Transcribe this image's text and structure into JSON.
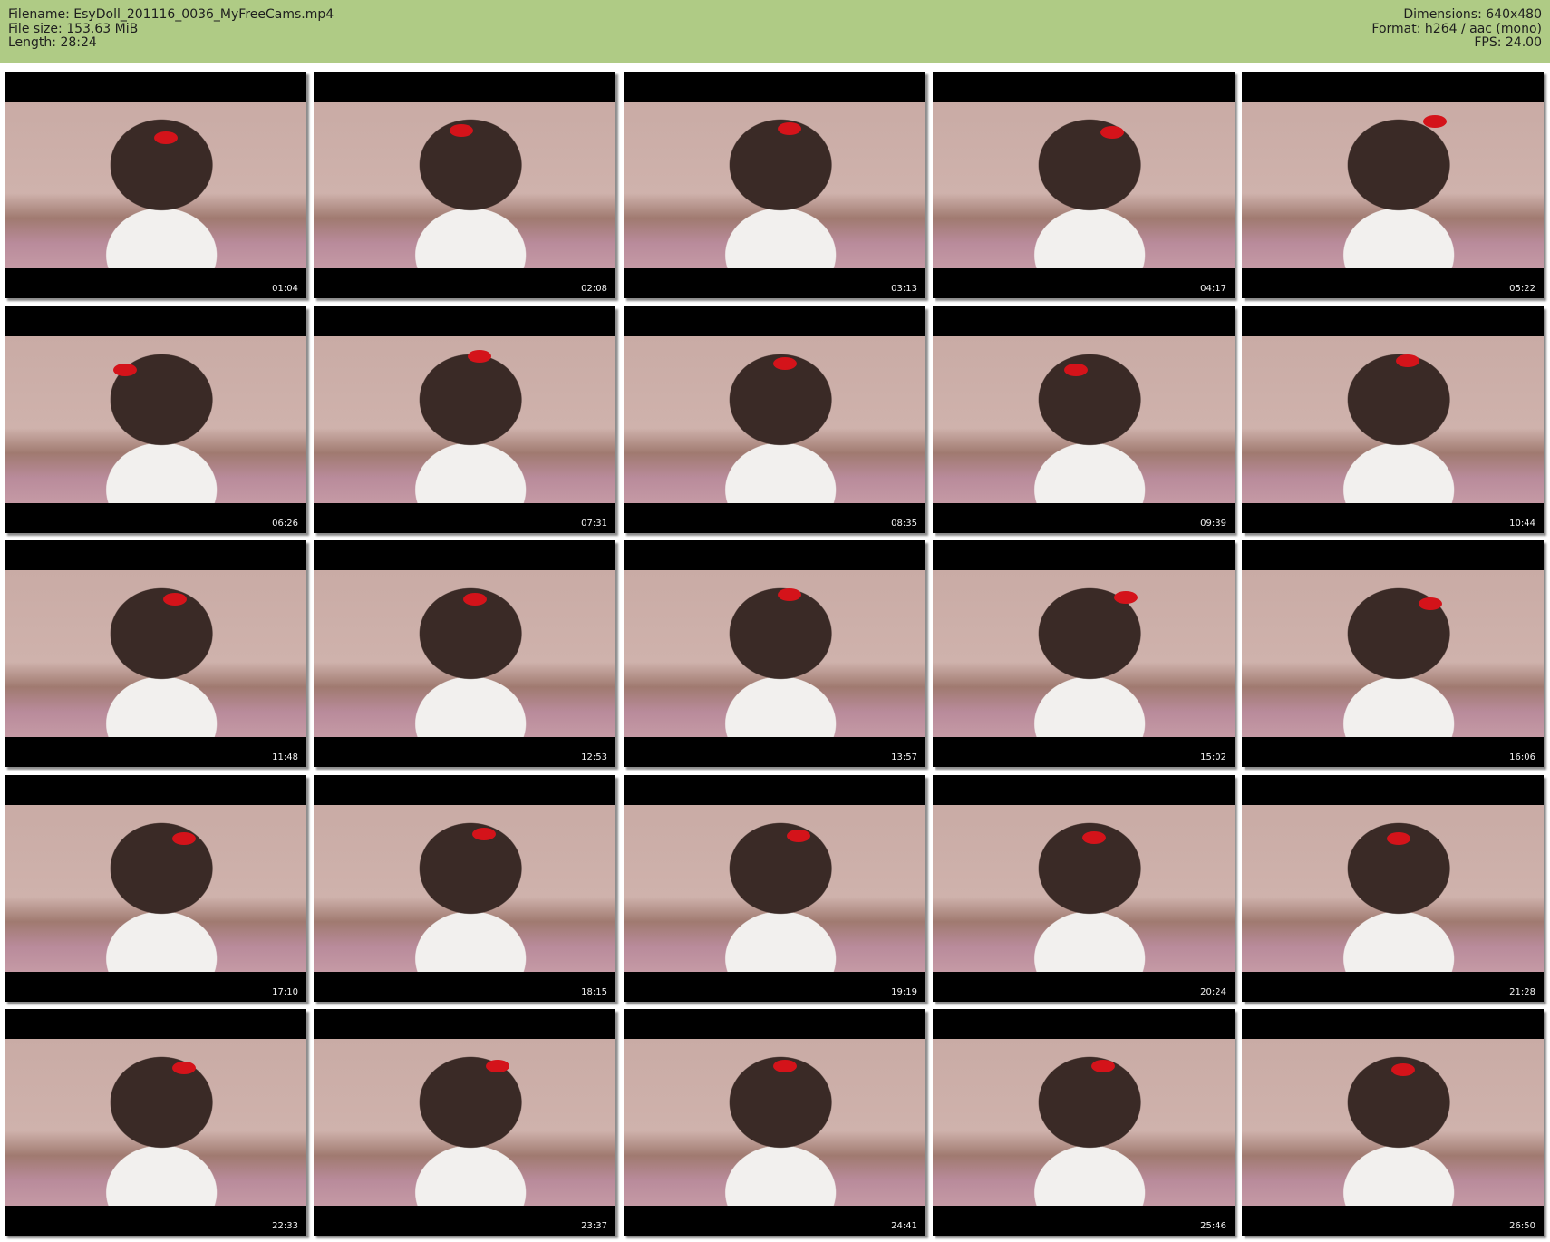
{
  "header": {
    "filename": "Filename: EsyDoll_201116_0036_MyFreeCams.mp4",
    "file_size": "File size: 153.63 MiB",
    "length": "Length: 28:24",
    "dimensions": "Dimensions: 640x480",
    "format": "Format: h264 / aac (mono)",
    "fps": "FPS: 24.00"
  },
  "thumbnails": [
    {
      "time": "01:04"
    },
    {
      "time": "02:08"
    },
    {
      "time": "03:13"
    },
    {
      "time": "04:17"
    },
    {
      "time": "05:22"
    },
    {
      "time": "06:26"
    },
    {
      "time": "07:31"
    },
    {
      "time": "08:35"
    },
    {
      "time": "09:39"
    },
    {
      "time": "10:44"
    },
    {
      "time": "11:48"
    },
    {
      "time": "12:53"
    },
    {
      "time": "13:57"
    },
    {
      "time": "15:02"
    },
    {
      "time": "16:06"
    },
    {
      "time": "17:10"
    },
    {
      "time": "18:15"
    },
    {
      "time": "19:19"
    },
    {
      "time": "20:24"
    },
    {
      "time": "21:28"
    },
    {
      "time": "22:33"
    },
    {
      "time": "23:37"
    },
    {
      "time": "24:41"
    },
    {
      "time": "25:46"
    },
    {
      "time": "26:50"
    }
  ],
  "colors": {
    "header_bg": "#afcb85",
    "letterbox": "#000000",
    "lip_red": "#d4131a"
  }
}
